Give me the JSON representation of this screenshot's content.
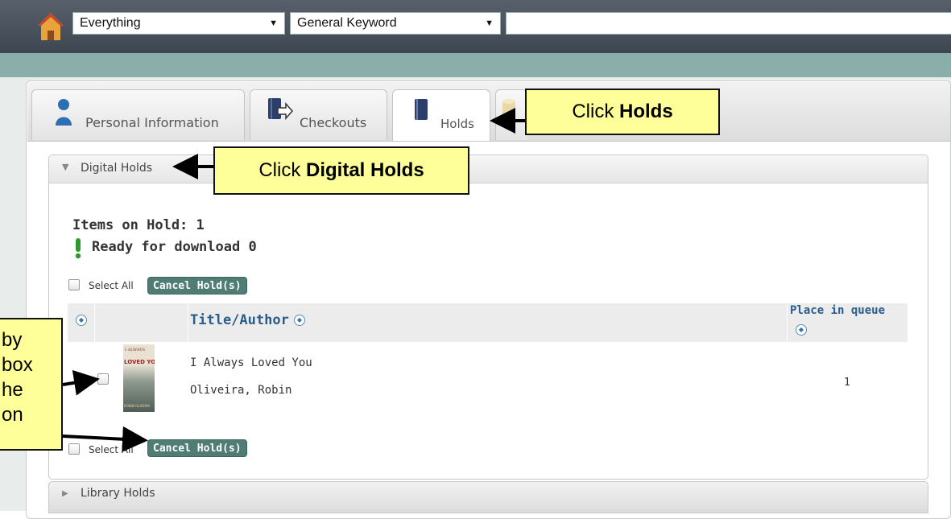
{
  "search": {
    "scope_value": "Everything",
    "field_value": "General Keyword",
    "query_value": ""
  },
  "tabs": [
    {
      "label": "Personal Information"
    },
    {
      "label": "Checkouts"
    },
    {
      "label": "Holds"
    }
  ],
  "digital_holds": {
    "section_label": "Digital Holds",
    "items_on_hold": "Items on Hold: 1",
    "ready_for_download": "Ready for download 0",
    "select_all_label": "Select All",
    "cancel_button_label": "Cancel Hold(s)",
    "columns": {
      "title_author": "Title/Author",
      "place_in_queue": "Place in queue"
    },
    "rows": [
      {
        "title": "I Always Loved You",
        "author": "Oliveira, Robin",
        "place_in_queue": "1",
        "cover_text_top": "I ALWAYS",
        "cover_text_mid": "LOVED YOU",
        "cover_text_bottom": "ROBIN OLIVEIRA"
      }
    ]
  },
  "library_holds": {
    "section_label": "Library Holds"
  },
  "annotations": {
    "holds_prefix": "Click ",
    "holds_bold": "Holds",
    "digital_prefix": "Click ",
    "digital_bold": "Digital Holds",
    "left_line1": "by",
    "left_line2": "box",
    "left_line3": "he",
    "left_line4": "on"
  },
  "colors": {
    "accent_button": "#4f7d74",
    "link_blue": "#2a5d8c",
    "callout_yellow": "#ffff99",
    "ready_icon_green": "#2e9a2e"
  }
}
